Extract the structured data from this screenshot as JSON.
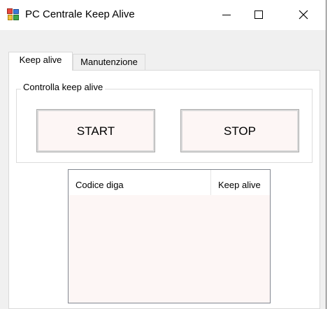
{
  "window": {
    "title": "PC Centrale Keep Alive",
    "controls": [
      "minimize",
      "maximize",
      "close"
    ]
  },
  "tabs": [
    {
      "label": "Keep alive",
      "selected": true
    },
    {
      "label": "Manutenzione",
      "selected": false
    }
  ],
  "keepalive_group": {
    "legend": "Controlla keep alive",
    "start_label": "START",
    "stop_label": "STOP"
  },
  "list": {
    "columns": [
      "Codice diga",
      "Keep alive"
    ],
    "rows": []
  },
  "icons": {
    "app": "app-icon",
    "minimize": "minimize-icon",
    "maximize": "maximize-icon",
    "close": "close-icon"
  },
  "colors": {
    "button_bg": "#fdf6f5",
    "list_bg": "#fdf6f5",
    "window_bg": "#f0f0f0"
  }
}
